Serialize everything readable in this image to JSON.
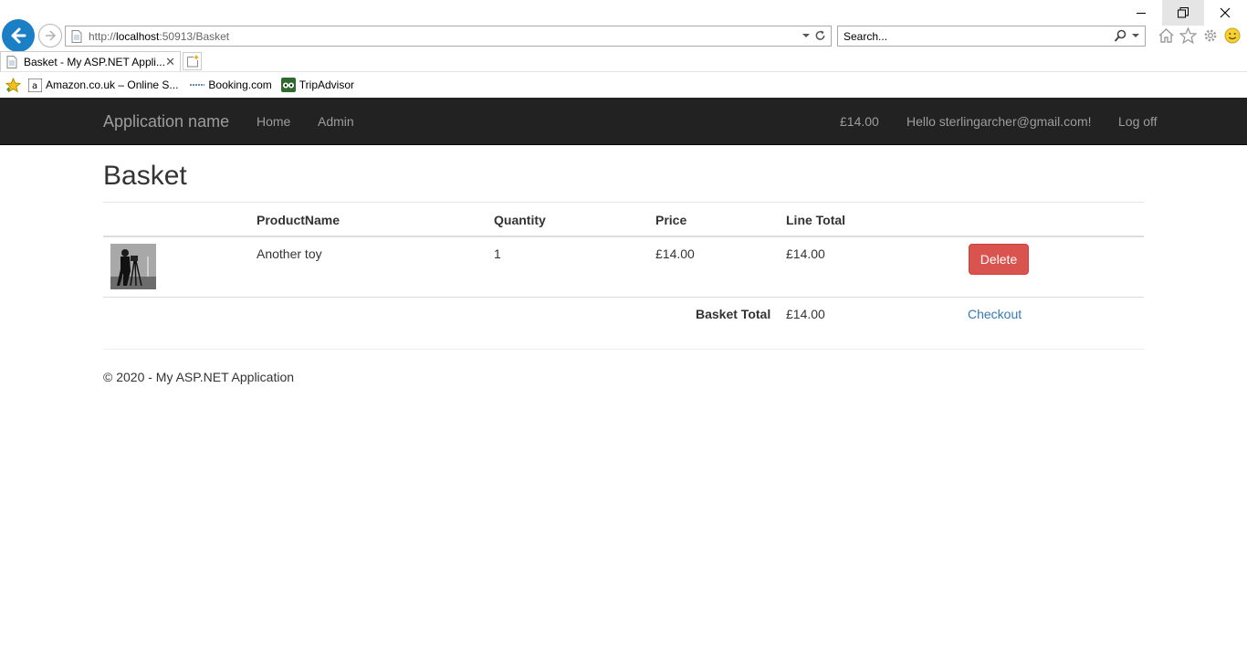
{
  "browser": {
    "url_prefix": "http://",
    "url_host": "localhost",
    "url_rest": ":50913/Basket",
    "search_placeholder": "Search...",
    "tab_title": "Basket - My ASP.NET Appli...",
    "tab_close": "✕",
    "favorites": [
      "Amazon.co.uk – Online S...",
      "Booking.com",
      "TripAdvisor"
    ]
  },
  "navbar": {
    "brand": "Application name",
    "home": "Home",
    "admin": "Admin",
    "basket_total": "£14.00",
    "greeting": "Hello sterlingarcher@gmail.com!",
    "logoff": "Log off"
  },
  "page": {
    "title": "Basket",
    "columns": [
      "ProductName",
      "Quantity",
      "Price",
      "Line Total"
    ],
    "rows": [
      {
        "product_name": "Another toy",
        "quantity": "1",
        "price": "£14.00",
        "line_total": "£14.00",
        "delete_label": "Delete"
      }
    ],
    "total_label": "Basket Total",
    "total_value": "£14.00",
    "checkout_label": "Checkout",
    "footer": "© 2020 - My ASP.NET Application"
  },
  "colors": {
    "navbar_bg": "#222222",
    "nav_text": "#9d9d9d",
    "danger": "#d9534f",
    "link": "#337ab7",
    "ie_blue": "#1a7fc4"
  }
}
